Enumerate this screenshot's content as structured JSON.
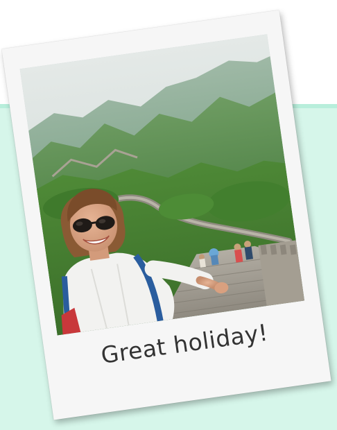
{
  "card": {
    "caption": "Great holiday!"
  },
  "photo": {
    "subject": "woman-smiling-on-great-wall"
  },
  "colors": {
    "background": "#ffffff",
    "mint_panel": "#d6f6ea",
    "polaroid_frame": "#f6f6f6",
    "caption_text": "#333333"
  }
}
